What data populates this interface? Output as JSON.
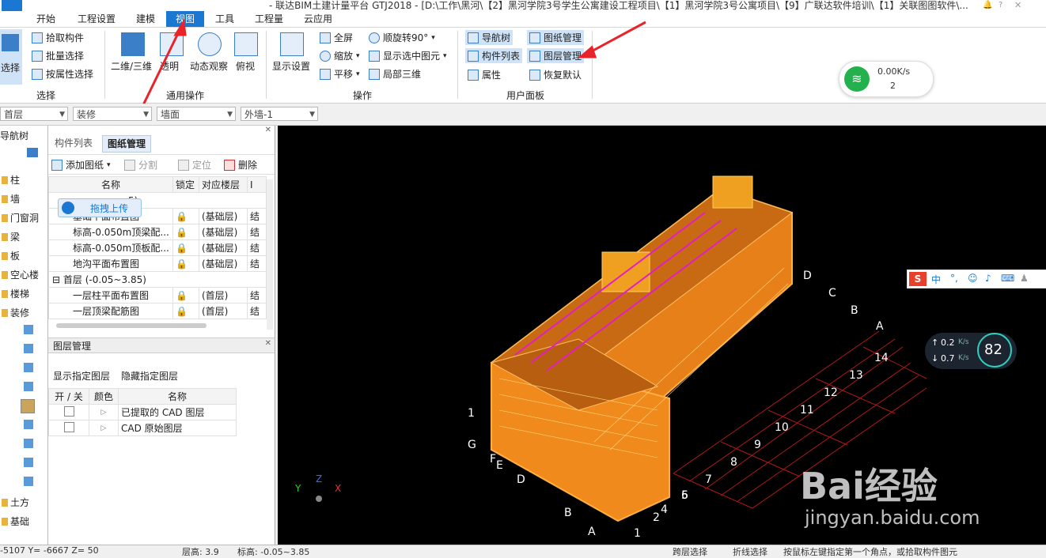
{
  "window": {
    "title": "- 联达BIM土建计量平台 GTJ2018 - [D:\\工作\\黑河\\【2】黑河学院3号学生公寓建设工程项目\\【1】黑河学院3号公寓项目\\【9】广联达软件培训\\【1】关联图图软件\\..."
  },
  "menu": {
    "items": [
      "开始",
      "工程设置",
      "建模",
      "视图",
      "工具",
      "工程量",
      "云应用"
    ],
    "active": "视图"
  },
  "ribbon": {
    "select_group": {
      "label": "选择",
      "big_button": "选择",
      "pick": "拾取构件",
      "batch": "批量选择",
      "by_attr": "按属性选择"
    },
    "common_group": {
      "label": "通用操作",
      "b2d3d": "二维/三维",
      "transparent": "透明",
      "dynamic": "动态观察",
      "topview": "俯视"
    },
    "operation_group": {
      "label": "操作",
      "display_settings": "显示设置",
      "fullscreen": "全屏",
      "zoom": "缩放",
      "pan": "平移",
      "rotate": "顺旋转90°",
      "show_selected": "显示选中图元",
      "local3d": "局部三维"
    },
    "userpanel_group": {
      "label": "用户面板",
      "navtree": "导航树",
      "drawing_mgmt": "图纸管理",
      "component_list": "构件列表",
      "layer_mgmt": "图层管理",
      "properties": "属性",
      "restore": "恢复默认"
    }
  },
  "filters": {
    "floor": "首层",
    "category": "装修",
    "type": "墙面",
    "item": "外墙-1"
  },
  "network": {
    "down": "0.00K/s",
    "count": "2"
  },
  "leftnav": {
    "title": "导航树",
    "items": [
      "柱",
      "墙",
      "门窗洞",
      "梁",
      "板",
      "空心楼",
      "楼梯",
      "装修",
      "土方",
      "基础"
    ]
  },
  "drawing_panel": {
    "tabs": [
      "构件列表",
      "图纸管理"
    ],
    "toolbar": {
      "add": "添加图纸",
      "split": "分割",
      "locate": "定位",
      "delete": "删除"
    },
    "columns": [
      "名称",
      "锁定",
      "对应楼层",
      "Ⅰ"
    ],
    "upload_badge": "拖拽上传",
    "group1_suffix": "5)",
    "rows": [
      {
        "name": "基础平面布置图",
        "floor": "(基础层)",
        "extra": "结"
      },
      {
        "name": "标高-0.050m顶梁配...",
        "floor": "(基础层)",
        "extra": "结"
      },
      {
        "name": "标高-0.050m顶板配...",
        "floor": "(基础层)",
        "extra": "结"
      },
      {
        "name": "地沟平面布置图",
        "floor": "(基础层)",
        "extra": "结"
      }
    ],
    "group2": "首层 (-0.05~3.85)",
    "rows2": [
      {
        "name": "一层柱平面布置图",
        "floor": "(首层)",
        "extra": "结"
      },
      {
        "name": "一层顶梁配筋图",
        "floor": "(首层)",
        "extra": "结"
      }
    ]
  },
  "layer_panel": {
    "title": "图层管理",
    "show_btn": "显示指定图层",
    "hide_btn": "隐藏指定图层",
    "columns": [
      "开 / 关",
      "颜色",
      "名称"
    ],
    "rows": [
      "已提取的 CAD 图层",
      "CAD 原始图层"
    ]
  },
  "speed_widget": {
    "up": "0.2",
    "down": "0.7",
    "unit": "K/s",
    "percent": "82"
  },
  "watermark": {
    "text": "Bai经验",
    "url": "jingyan.baidu.com"
  },
  "axis_labels": {
    "top": [
      "D",
      "C",
      "B",
      "A",
      "14",
      "13",
      "12",
      "11",
      "10",
      "9",
      "8",
      "7",
      "6",
      "5",
      "4"
    ],
    "bottom": [
      "1",
      "G",
      "F",
      "E",
      "D",
      "B",
      "A",
      "1",
      "2"
    ]
  },
  "status": {
    "coords": "-5107 Y= -6667 Z= 50",
    "floor_h": "层高: 3.9",
    "elev": "标高: -0.05~3.85",
    "mode": "跨层选择",
    "cross": "折线选择",
    "hint": "按鼠标左键指定第一个角点，或拾取构件图元"
  },
  "colors": {
    "accent": "#1a78d2",
    "building": "#f08a1c",
    "highlight": "#cfe3f8"
  }
}
